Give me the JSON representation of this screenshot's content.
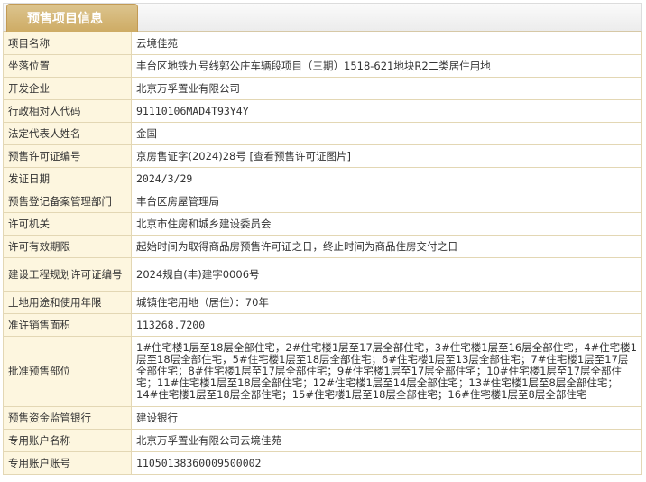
{
  "tab": {
    "title": "预售项目信息"
  },
  "rows": [
    {
      "label": "项目名称",
      "value": "云境佳苑"
    },
    {
      "label": "坐落位置",
      "value": "丰台区地铁九号线郭公庄车辆段项目（三期）1518-621地块R2二类居住用地"
    },
    {
      "label": "开发企业",
      "value": "北京万孚置业有限公司"
    },
    {
      "label": "行政相对人代码",
      "value": "91110106MAD4T93Y4Y"
    },
    {
      "label": "法定代表人姓名",
      "value": "金国"
    },
    {
      "label": "预售许可证编号",
      "value": "京房售证字(2024)28号 [查看预售许可证图片]"
    },
    {
      "label": "发证日期",
      "value": "2024/3/29"
    },
    {
      "label": "预售登记备案管理部门",
      "value": "丰台区房屋管理局"
    },
    {
      "label": "许可机关",
      "value": "北京市住房和城乡建设委员会"
    },
    {
      "label": "许可有效期限",
      "value": "起始时间为取得商品房预售许可证之日，终止时间为商品住房交付之日"
    },
    {
      "label": "建设工程规划许可证编号",
      "value": "2024规自(丰)建字0006号"
    },
    {
      "label": "土地用途和使用年限",
      "value": "城镇住宅用地（居住）：70年"
    },
    {
      "label": "准许销售面积",
      "value": "113268.7200"
    },
    {
      "label": "批准预售部位",
      "value": "1#住宅楼1层至18层全部住宅，2#住宅楼1层至17层全部住宅，3#住宅楼1层至16层全部住宅，4#住宅楼1层至18层全部住宅，5#住宅楼1层至18层全部住宅；6#住宅楼1层至13层全部住宅；7#住宅楼1层至17层全部住宅；8#住宅楼1层至17层全部住宅；9#住宅楼1层至17层全部住宅；10#住宅楼1层至17层全部住宅；11#住宅楼1层至18层全部住宅；12#住宅楼1层至14层全部住宅；13#住宅楼1层至8层全部住宅；14#住宅楼1层至18层全部住宅；15#住宅楼1层至18层全部住宅；16#住宅楼1层至8层全部住宅"
    },
    {
      "label": "预售资金监管银行",
      "value": "建设银行"
    },
    {
      "label": "专用账户名称",
      "value": "北京万孚置业有限公司云境佳苑"
    },
    {
      "label": "专用账户账号",
      "value": "11050138360009500002"
    }
  ],
  "colors": {
    "tab_bg": "#cdaa62",
    "label_bg": "#fdf6df",
    "border": "#e3d7b4"
  }
}
